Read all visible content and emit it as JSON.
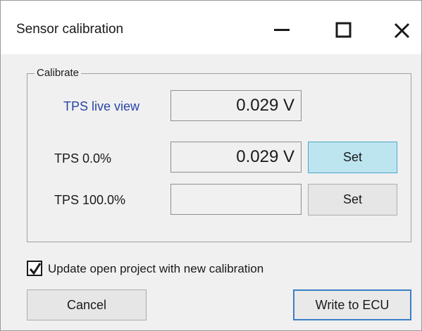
{
  "window": {
    "title": "Sensor calibration",
    "controls": {
      "minimize_icon": "minimize-icon",
      "maximize_icon": "maximize-icon",
      "close_icon": "close-icon"
    }
  },
  "calibrate": {
    "legend": "Calibrate",
    "live": {
      "label": "TPS live view",
      "value": "0.029 V"
    },
    "rows": [
      {
        "label": "TPS  0.0%",
        "value": "0.029 V",
        "button": "Set",
        "highlighted": true
      },
      {
        "label": "TPS  100.0%",
        "value": "",
        "button": "Set",
        "highlighted": false
      }
    ]
  },
  "options": {
    "update_project_label": "Update open project with new calibration",
    "update_project_checked": true
  },
  "footer": {
    "cancel_label": "Cancel",
    "write_label": "Write to ECU"
  },
  "colors": {
    "live_label": "#2b44a8",
    "set_highlight": "#bde5ef",
    "primary_border": "#3c7fc8"
  }
}
